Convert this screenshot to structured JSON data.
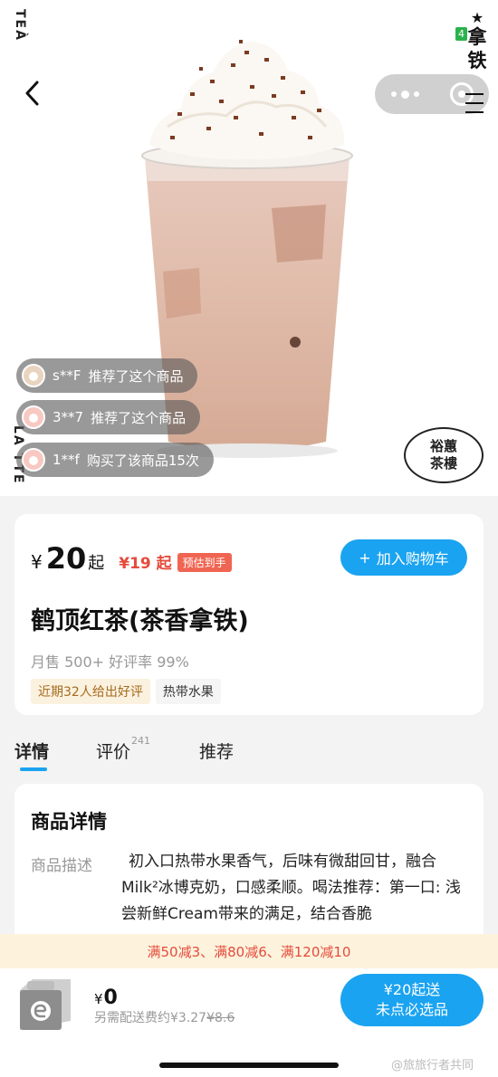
{
  "hero": {
    "side_top": "TEÀ",
    "side_bottom": "LA TTE",
    "vert_title_chars": [
      "拿",
      "铁"
    ],
    "badge_number": "4",
    "logo_text": [
      "裕蕙",
      "茶樓"
    ],
    "social_proof": [
      {
        "user": "s**F",
        "text": "推荐了这个商品"
      },
      {
        "user": "3**7",
        "text": "推荐了这个商品"
      },
      {
        "user": "1**f",
        "text": "购买了该商品15次"
      }
    ]
  },
  "product": {
    "currency": "¥",
    "price": "20",
    "price_suffix": "起",
    "discount_price": "¥19 起",
    "estimate_tag": "预估到手",
    "add_cart_label": "加入购物车",
    "title": "鹤顶红茶(茶香拿铁)",
    "sales": "月售 500+ 好评率 99%",
    "tags": [
      "近期32人给出好评",
      "热带水果"
    ]
  },
  "tabs": [
    {
      "label": "详情",
      "active": true
    },
    {
      "label": "评价",
      "count": "241",
      "active": false
    },
    {
      "label": "推荐",
      "active": false
    }
  ],
  "detail": {
    "section_title": "商品详情",
    "desc_label": "商品描述",
    "desc_text": "初入口热带水果香气，后味有微甜回甘，融合Milk²冰博克奶，口感柔顺。喝法推荐：第一口: 浅尝新鲜Cream带来的满足，结合香脆"
  },
  "promo": "满50减3、满80减6、满120减10",
  "bottom_bar": {
    "currency": "¥",
    "total": "0",
    "fee_label": "另需配送费约¥3.27",
    "fee_original": "¥8.6",
    "checkout_line1": "¥20起送",
    "checkout_line2": "未点必选品",
    "watermark": "@旅旅行者共同"
  },
  "colors": {
    "accent_blue": "#1aa3f0",
    "price_red": "#e54b3c",
    "promo_bg": "#fdf3dd"
  },
  "icons": [
    "back-chevron-icon",
    "more-dots-icon",
    "close-target-icon",
    "shopping-bag-icon",
    "plus-icon"
  ]
}
